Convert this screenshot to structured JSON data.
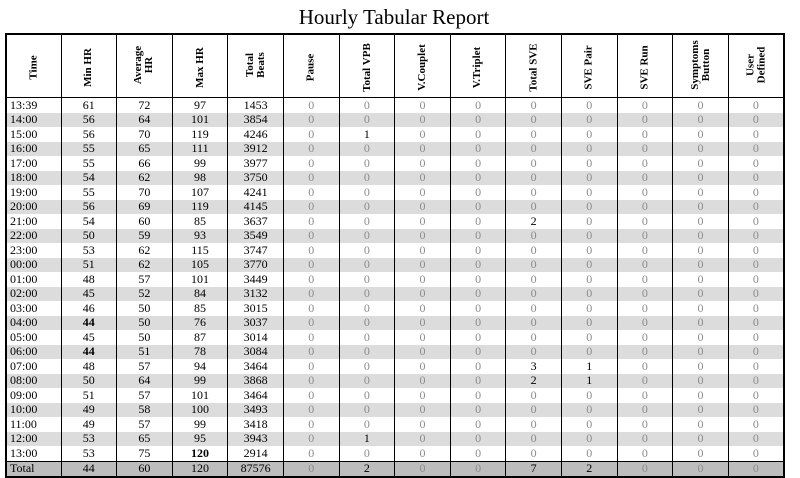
{
  "title": "Hourly Tabular Report",
  "columns": [
    [
      "Time"
    ],
    [
      "Min HR"
    ],
    [
      "Average",
      "HR"
    ],
    [
      "Max HR"
    ],
    [
      "Total",
      "Beats"
    ],
    [
      "Pause"
    ],
    [
      "Total VPB"
    ],
    [
      "V.Couplet"
    ],
    [
      "V.Triplet"
    ],
    [
      "Total SVE"
    ],
    [
      "SVE Pair"
    ],
    [
      "SVE Run"
    ],
    [
      "Symptoms",
      "Button"
    ],
    [
      "User",
      "Defined"
    ]
  ],
  "rows": [
    [
      "13:39",
      "61",
      "72",
      "97",
      "1453",
      "0",
      "0",
      "0",
      "0",
      "0",
      "0",
      "0",
      "0",
      "0"
    ],
    [
      "14:00",
      "56",
      "64",
      "101",
      "3854",
      "0",
      "0",
      "0",
      "0",
      "0",
      "0",
      "0",
      "0",
      "0"
    ],
    [
      "15:00",
      "56",
      "70",
      "119",
      "4246",
      "0",
      "1",
      "0",
      "0",
      "0",
      "0",
      "0",
      "0",
      "0"
    ],
    [
      "16:00",
      "55",
      "65",
      "111",
      "3912",
      "0",
      "0",
      "0",
      "0",
      "0",
      "0",
      "0",
      "0",
      "0"
    ],
    [
      "17:00",
      "55",
      "66",
      "99",
      "3977",
      "0",
      "0",
      "0",
      "0",
      "0",
      "0",
      "0",
      "0",
      "0"
    ],
    [
      "18:00",
      "54",
      "62",
      "98",
      "3750",
      "0",
      "0",
      "0",
      "0",
      "0",
      "0",
      "0",
      "0",
      "0"
    ],
    [
      "19:00",
      "55",
      "70",
      "107",
      "4241",
      "0",
      "0",
      "0",
      "0",
      "0",
      "0",
      "0",
      "0",
      "0"
    ],
    [
      "20:00",
      "56",
      "69",
      "119",
      "4145",
      "0",
      "0",
      "0",
      "0",
      "0",
      "0",
      "0",
      "0",
      "0"
    ],
    [
      "21:00",
      "54",
      "60",
      "85",
      "3637",
      "0",
      "0",
      "0",
      "0",
      "2",
      "0",
      "0",
      "0",
      "0"
    ],
    [
      "22:00",
      "50",
      "59",
      "93",
      "3549",
      "0",
      "0",
      "0",
      "0",
      "0",
      "0",
      "0",
      "0",
      "0"
    ],
    [
      "23:00",
      "53",
      "62",
      "115",
      "3747",
      "0",
      "0",
      "0",
      "0",
      "0",
      "0",
      "0",
      "0",
      "0"
    ],
    [
      "00:00",
      "51",
      "62",
      "105",
      "3770",
      "0",
      "0",
      "0",
      "0",
      "0",
      "0",
      "0",
      "0",
      "0"
    ],
    [
      "01:00",
      "48",
      "57",
      "101",
      "3449",
      "0",
      "0",
      "0",
      "0",
      "0",
      "0",
      "0",
      "0",
      "0"
    ],
    [
      "02:00",
      "45",
      "52",
      "84",
      "3132",
      "0",
      "0",
      "0",
      "0",
      "0",
      "0",
      "0",
      "0",
      "0"
    ],
    [
      "03:00",
      "46",
      "50",
      "85",
      "3015",
      "0",
      "0",
      "0",
      "0",
      "0",
      "0",
      "0",
      "0",
      "0"
    ],
    [
      "04:00",
      "44",
      "50",
      "76",
      "3037",
      "0",
      "0",
      "0",
      "0",
      "0",
      "0",
      "0",
      "0",
      "0"
    ],
    [
      "05:00",
      "45",
      "50",
      "87",
      "3014",
      "0",
      "0",
      "0",
      "0",
      "0",
      "0",
      "0",
      "0",
      "0"
    ],
    [
      "06:00",
      "44",
      "51",
      "78",
      "3084",
      "0",
      "0",
      "0",
      "0",
      "0",
      "0",
      "0",
      "0",
      "0"
    ],
    [
      "07:00",
      "48",
      "57",
      "94",
      "3464",
      "0",
      "0",
      "0",
      "0",
      "3",
      "1",
      "0",
      "0",
      "0"
    ],
    [
      "08:00",
      "50",
      "64",
      "99",
      "3868",
      "0",
      "0",
      "0",
      "0",
      "2",
      "1",
      "0",
      "0",
      "0"
    ],
    [
      "09:00",
      "51",
      "57",
      "101",
      "3464",
      "0",
      "0",
      "0",
      "0",
      "0",
      "0",
      "0",
      "0",
      "0"
    ],
    [
      "10:00",
      "49",
      "58",
      "100",
      "3493",
      "0",
      "0",
      "0",
      "0",
      "0",
      "0",
      "0",
      "0",
      "0"
    ],
    [
      "11:00",
      "49",
      "57",
      "99",
      "3418",
      "0",
      "0",
      "0",
      "0",
      "0",
      "0",
      "0",
      "0",
      "0"
    ],
    [
      "12:00",
      "53",
      "65",
      "95",
      "3943",
      "0",
      "1",
      "0",
      "0",
      "0",
      "0",
      "0",
      "0",
      "0"
    ],
    [
      "13:00",
      "53",
      "75",
      "120",
      "2914",
      "0",
      "0",
      "0",
      "0",
      "0",
      "0",
      "0",
      "0",
      "0"
    ]
  ],
  "total": [
    "Total",
    "44",
    "60",
    "120",
    "87576",
    "0",
    "2",
    "0",
    "0",
    "7",
    "2",
    "0",
    "0",
    "0"
  ],
  "bold_cells": [
    [
      15,
      1
    ],
    [
      17,
      1
    ],
    [
      24,
      3
    ]
  ]
}
